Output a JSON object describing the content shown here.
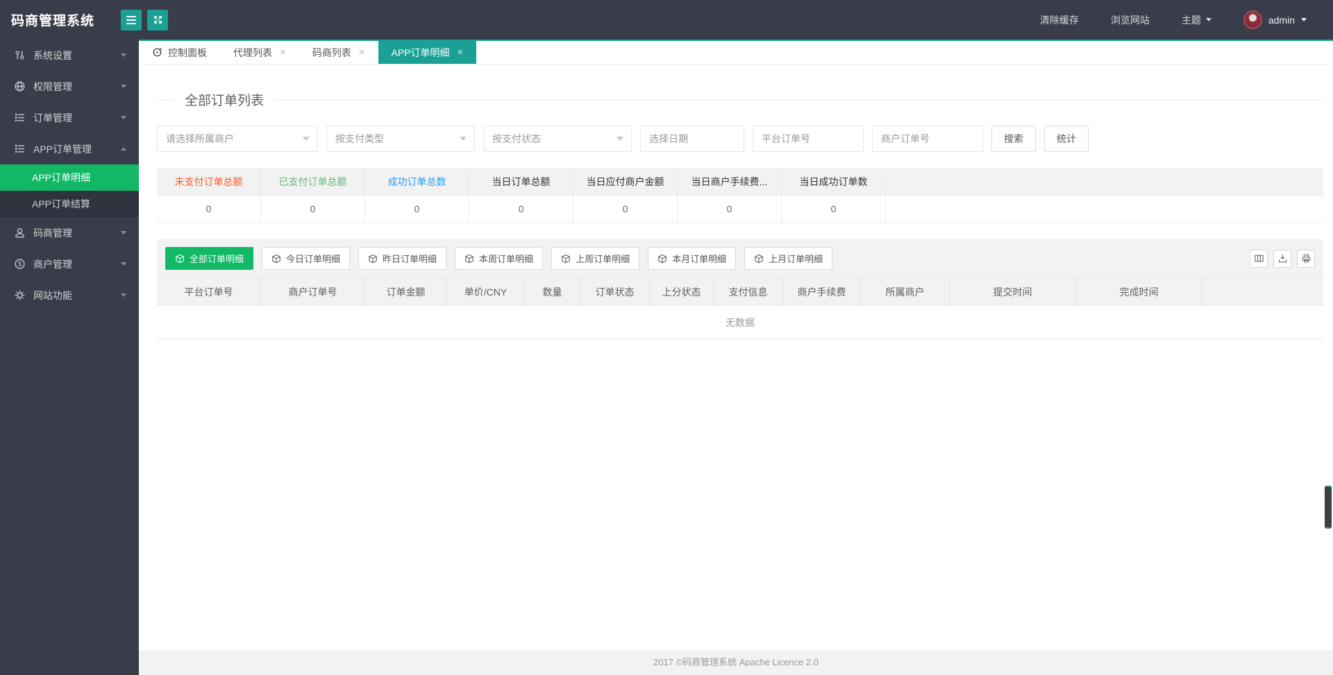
{
  "app": {
    "title": "码商管理系统"
  },
  "colors": {
    "teal_accent": "#1aa094",
    "green_accent": "#12b866",
    "header_dark": "#393d49",
    "stat_red": "#ff5722",
    "stat_green": "#5fb878",
    "stat_blue": "#1e9fff"
  },
  "icons": {
    "close": "×",
    "dollar_glyph": "$"
  },
  "header": {
    "clear_cache": "清除缓存",
    "browse_site": "浏览网站",
    "theme": "主题",
    "username": "admin"
  },
  "sidebar": {
    "items": [
      {
        "label": "系统设置",
        "icon": "settings-icon"
      },
      {
        "label": "权限管理",
        "icon": "globe-icon"
      },
      {
        "label": "订单管理",
        "icon": "list-icon"
      },
      {
        "label": "APP订单管理",
        "icon": "list-icon",
        "expanded": true,
        "children": [
          {
            "label": "APP订单明细",
            "active": true
          },
          {
            "label": "APP订单结算"
          }
        ]
      },
      {
        "label": "码商管理",
        "icon": "user-icon"
      },
      {
        "label": "商户管理",
        "icon": "dollar-icon"
      },
      {
        "label": "网站功能",
        "icon": "gear-icon"
      }
    ]
  },
  "tabs": [
    {
      "label": "控制面板",
      "icon": "console-icon",
      "closable": false
    },
    {
      "label": "代理列表",
      "closable": true
    },
    {
      "label": "码商列表",
      "closable": true
    },
    {
      "label": "APP订单明细",
      "closable": true,
      "active": true
    }
  ],
  "main": {
    "section_title": "全部订单列表",
    "filters": {
      "merchant_select": "请选择所属商户",
      "pay_type_select": "按支付类型",
      "pay_status_select": "按支付状态",
      "date_placeholder": "选择日期",
      "platform_order_placeholder": "平台订单号",
      "merchant_order_placeholder": "商户订单号",
      "search_button": "搜索",
      "stats_button": "统计"
    },
    "summary": {
      "columns": [
        {
          "label": "未支付订单总额",
          "value": "0",
          "color": "#ff5722"
        },
        {
          "label": "已支付订单总额",
          "value": "0",
          "color": "#5fb878"
        },
        {
          "label": "成功订单总数",
          "value": "0",
          "color": "#1e9fff"
        },
        {
          "label": "当日订单总额",
          "value": "0",
          "color": "#333333"
        },
        {
          "label": "当日应付商户金额",
          "value": "0",
          "color": "#333333"
        },
        {
          "label": "当日商户手续费...",
          "value": "0",
          "color": "#333333"
        },
        {
          "label": "当日成功订单数",
          "value": "0",
          "color": "#333333"
        }
      ]
    },
    "toolbar": {
      "buttons": [
        {
          "label": "全部订单明细",
          "active": true
        },
        {
          "label": "今日订单明细"
        },
        {
          "label": "昨日订单明细"
        },
        {
          "label": "本周订单明细"
        },
        {
          "label": "上周订单明细"
        },
        {
          "label": "本月订单明细"
        },
        {
          "label": "上月订单明细"
        }
      ],
      "tools": [
        "columns-icon",
        "export-icon",
        "print-icon"
      ]
    },
    "table": {
      "columns": [
        "平台订单号",
        "商户订单号",
        "订单金额",
        "单价/CNY",
        "数量",
        "订单状态",
        "上分状态",
        "支付信息",
        "商户手续费",
        "所属商户",
        "提交时间",
        "完成时间"
      ],
      "empty_text": "无数据"
    }
  },
  "footer": {
    "text": "2017 ©码商管理系统 Apache Licence 2.0"
  }
}
